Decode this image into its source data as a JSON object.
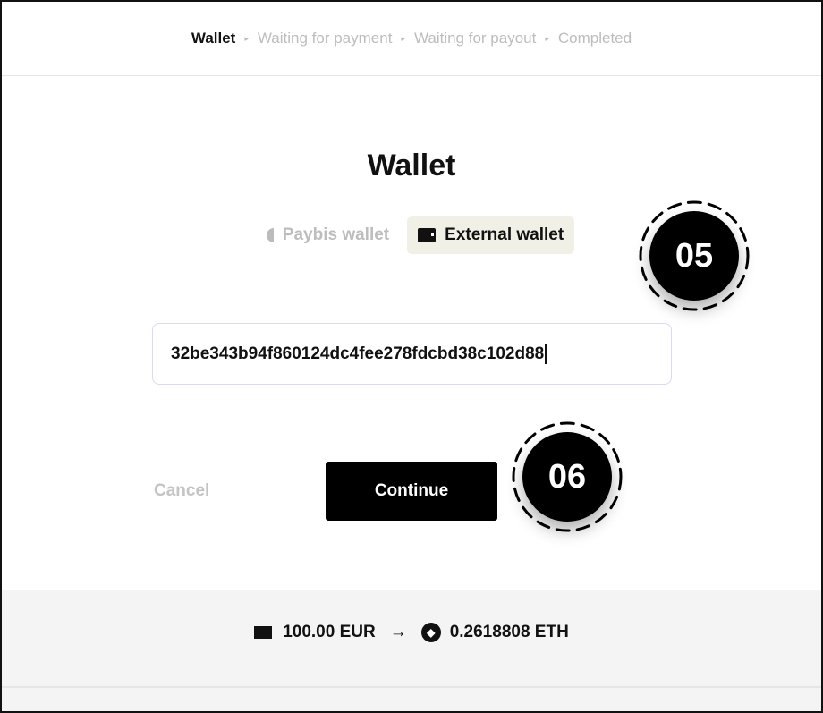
{
  "steps": [
    {
      "label": "Wallet",
      "active": true
    },
    {
      "label": "Waiting for payment"
    },
    {
      "label": "Waiting for payout"
    },
    {
      "label": "Completed"
    }
  ],
  "step_separator": "▸",
  "title": "Wallet",
  "tabs": [
    {
      "label": "Paybis wallet",
      "icon": "half-circle-icon",
      "selected": false
    },
    {
      "label": "External wallet",
      "icon": "wallet-icon",
      "selected": true
    }
  ],
  "address_value": "32be343b94f860124dc4fee278fdcbd38c102d88",
  "buttons": {
    "cancel": "Cancel",
    "continue": "Continue"
  },
  "annotations": [
    "05",
    "06"
  ],
  "summary": {
    "from": "100.00 EUR",
    "arrow": "→",
    "to": "0.2618808 ETH"
  }
}
